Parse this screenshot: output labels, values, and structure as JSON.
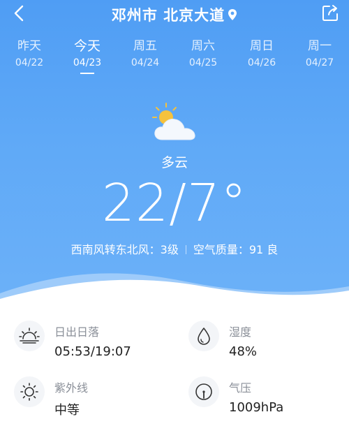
{
  "header": {
    "title": "邓州市 北京大道"
  },
  "days": [
    {
      "name": "昨天",
      "date": "04/22",
      "active": false
    },
    {
      "name": "今天",
      "date": "04/23",
      "active": true
    },
    {
      "name": "周五",
      "date": "04/24",
      "active": false
    },
    {
      "name": "周六",
      "date": "04/25",
      "active": false
    },
    {
      "name": "周日",
      "date": "04/26",
      "active": false
    },
    {
      "name": "周一",
      "date": "04/27",
      "active": false
    }
  ],
  "current": {
    "condition": "多云",
    "temperature": "22/7°",
    "wind": "西南风转东北风：3级",
    "air_quality": "空气质量：91 良",
    "icon": "partly-cloudy-icon"
  },
  "details": {
    "sunrise_sunset": {
      "label": "日出日落",
      "value": "05:53/19:07",
      "icon": "sunrise-icon"
    },
    "humidity": {
      "label": "湿度",
      "value": "48%",
      "icon": "droplet-icon"
    },
    "uv": {
      "label": "紫外线",
      "value": "中等",
      "icon": "sun-icon"
    },
    "pressure": {
      "label": "气压",
      "value": "1009hPa",
      "icon": "gauge-icon"
    }
  },
  "colors": {
    "sky_top": "#4f9df4",
    "sky_bottom": "#6cb1f8",
    "sun": "#f5c23d"
  }
}
